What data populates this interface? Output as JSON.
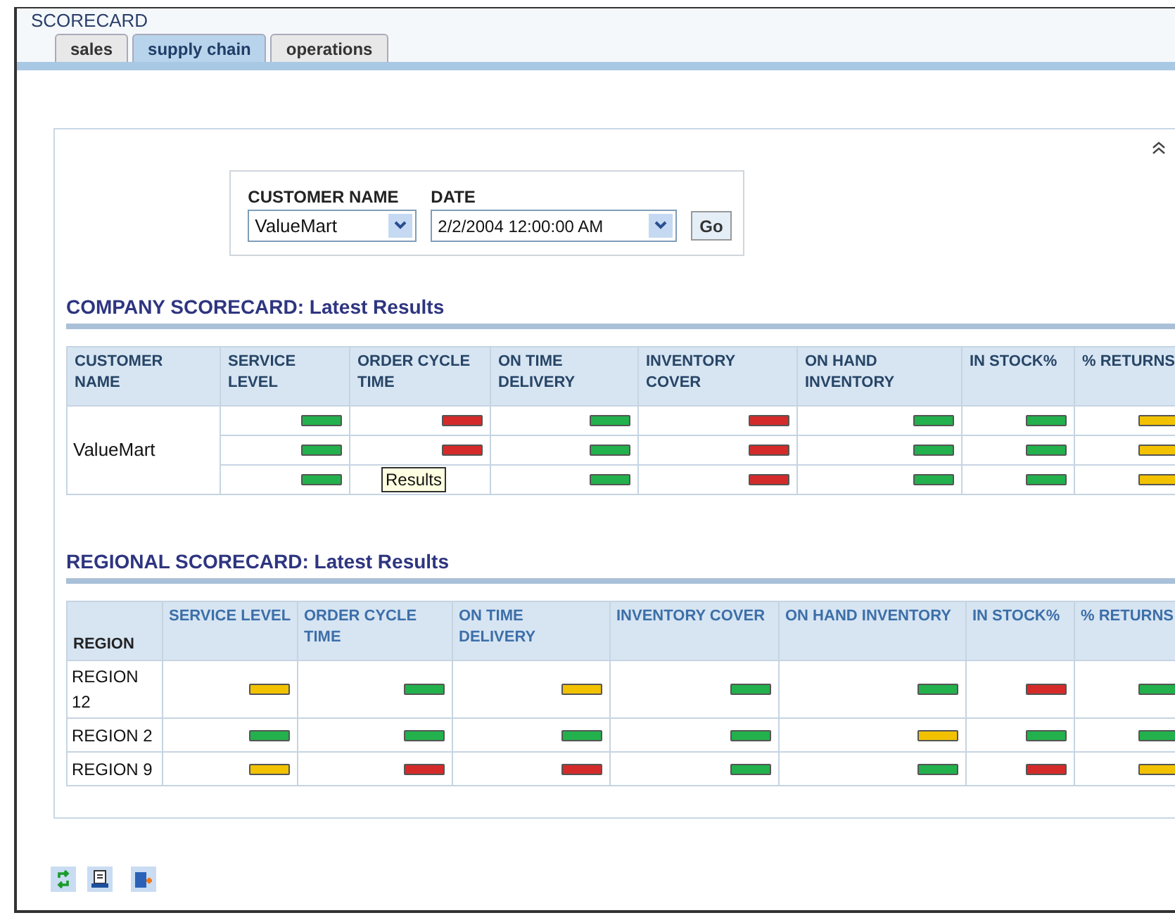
{
  "title": "SCORECARD",
  "tabs": [
    {
      "label": "sales",
      "selected": false
    },
    {
      "label": "supply chain",
      "selected": true
    },
    {
      "label": "operations",
      "selected": false
    }
  ],
  "filters": {
    "customer": {
      "label": "CUSTOMER NAME",
      "value": "ValueMart"
    },
    "date": {
      "label": "DATE",
      "value": "2/2/2004 12:00:00 AM"
    },
    "go": "Go"
  },
  "company": {
    "heading": "COMPANY SCORECARD: Latest Results",
    "columns": [
      "CUSTOMER NAME",
      "SERVICE LEVEL",
      "ORDER CYCLE TIME",
      "ON TIME DELIVERY",
      "INVENTORY COVER",
      "ON HAND INVENTORY",
      "IN STOCK%",
      "% RETURNS"
    ],
    "rows": [
      [
        {
          "text": "ValueMart",
          "rowspan": 3
        },
        {
          "color": "#22b14c"
        },
        {
          "color": "#d42a2a"
        },
        {
          "color": "#22b14c"
        },
        {
          "color": "#d42a2a"
        },
        {
          "color": "#22b14c"
        },
        {
          "color": "#22b14c"
        },
        {
          "color": "#f2c200"
        }
      ],
      [
        {
          "color": "#22b14c"
        },
        {
          "color": "#d42a2a"
        },
        {
          "color": "#22b14c"
        },
        {
          "color": "#d42a2a"
        },
        {
          "color": "#22b14c"
        },
        {
          "color": "#22b14c"
        },
        {
          "color": "#f2c200"
        }
      ],
      [
        {
          "color": "#22b14c"
        },
        {
          "tooltip": "Results"
        },
        {
          "color": "#22b14c"
        },
        {
          "color": "#d42a2a"
        },
        {
          "color": "#22b14c"
        },
        {
          "color": "#22b14c"
        },
        {
          "color": "#f2c200"
        }
      ]
    ]
  },
  "regional": {
    "heading": "REGIONAL SCORECARD: Latest Results",
    "columns": [
      "REGION",
      "SERVICE LEVEL",
      "ORDER CYCLE TIME",
      "ON TIME DELIVERY",
      "INVENTORY COVER",
      "ON HAND INVENTORY",
      "IN STOCK%",
      "% RETURNS"
    ],
    "rows": [
      {
        "region": "REGION 12",
        "cells": [
          {
            "color": "#f2c200"
          },
          {
            "color": "#22b14c"
          },
          {
            "color": "#f2c200"
          },
          {
            "color": "#22b14c"
          },
          {
            "color": "#22b14c"
          },
          {
            "color": "#d42a2a"
          },
          {
            "color": "#22b14c"
          }
        ]
      },
      {
        "region": "REGION 2",
        "cells": [
          {
            "color": "#22b14c"
          },
          {
            "color": "#22b14c"
          },
          {
            "color": "#22b14c"
          },
          {
            "color": "#22b14c"
          },
          {
            "color": "#f2c200"
          },
          {
            "color": "#22b14c"
          },
          {
            "color": "#22b14c"
          }
        ]
      },
      {
        "region": "REGION 9",
        "cells": [
          {
            "color": "#f2c200"
          },
          {
            "color": "#d42a2a"
          },
          {
            "color": "#d42a2a"
          },
          {
            "color": "#22b14c"
          },
          {
            "color": "#22b14c"
          },
          {
            "color": "#d42a2a"
          },
          {
            "color": "#f2c200"
          }
        ]
      }
    ]
  }
}
